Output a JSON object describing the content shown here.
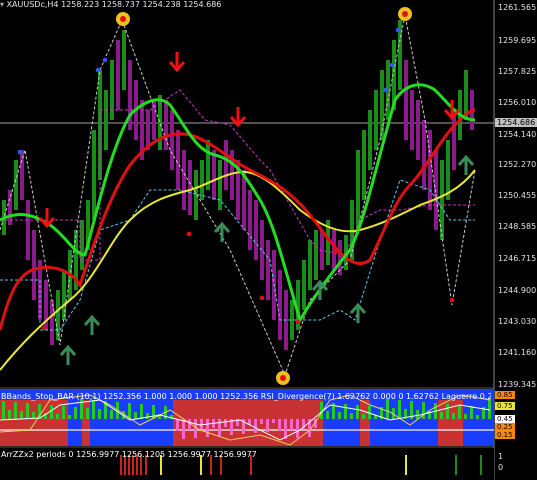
{
  "header": {
    "symbol_text": "XAUUSDc,H4",
    "ohlc": "1258.223 1258.737 1254.238 1254.686"
  },
  "price_axis": {
    "labels": [
      "1261.565",
      "1259.695",
      "1257.825",
      "1256.010",
      "1254.140",
      "1252.270",
      "1250.455",
      "1248.585",
      "1246.715",
      "1244.900",
      "1243.030",
      "1241.160",
      "1239.345"
    ],
    "current_price": "1254.686",
    "current_price_color": "#c0c0c0"
  },
  "indicator1": {
    "text": "BBands_Stop_BAR (10,1) 1252.356  1.000  1.000  1.000 1252.356  RSI_Divergence(7) 1.62762 0.000  0 1.62762  Laguerre 0.2",
    "levels": [
      "0.85",
      "0.75",
      "0.45",
      "0.25",
      "0.15"
    ]
  },
  "indicator2": {
    "text": "ArrZZx2 periods 0  1256.9977  1256.1205  1256.9977  1256.9977",
    "levels": [
      "1",
      "0"
    ]
  },
  "colors": {
    "bull_bar": "#1a8c1a",
    "bear_bar": "#8b1a8b",
    "green_ma": "#22dd22",
    "red_ma": "#e01010",
    "yellow_ma": "#e8e830",
    "arrow_down": "#ee1111",
    "arrow_up": "#3a8c5a",
    "zigzag": "#cccccc"
  },
  "icons": {
    "sell_arrow": "red-down-arrow-icon",
    "buy_arrow": "green-up-arrow-icon",
    "zigzag_marker": "yellow-circle-marker-icon"
  }
}
